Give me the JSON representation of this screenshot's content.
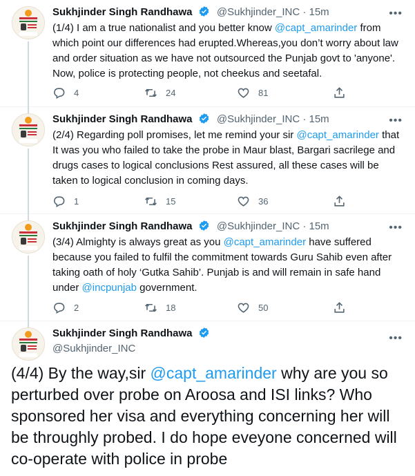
{
  "author": {
    "name": "Sukhjinder Singh Randhawa",
    "handle": "@Sukhjinder_INC",
    "avatar_text": "ਸੁਖਜਿੰਦਰ ਸਿੰਘ ਰੰਧਾਵਾ"
  },
  "tweets": [
    {
      "time": "15m",
      "text_parts": [
        "(1/4) I am a true nationalist and you better know ",
        "@capt_amarinder",
        " from which point our differences had erupted.Whereas,you don’t worry about law and order situation as we have not outsourced the Punjab govt to 'anyone'. Now, police is protecting people, not cheekus and seetafal."
      ],
      "replies": "4",
      "retweets": "24",
      "likes": "81"
    },
    {
      "time": "15m",
      "text_parts": [
        "(2/4) Regarding poll promises, let me remind your sir ",
        "@capt_amarinder",
        " that It was you who failed to take the probe in Maur blast, Bargari sacrilege and drugs cases to logical conclusions Rest assured, all these cases will be taken to logical conclusion in coming days."
      ],
      "replies": "1",
      "retweets": "15",
      "likes": "36"
    },
    {
      "time": "15m",
      "text_parts": [
        "(3/4) Almighty is always great as you ",
        "@capt_amarinder",
        " have suffered because you failed to fulfil the commitment towards Guru Sahib even after taking oath of holy ‘Gutka Sahib’. Punjab is and will remain in safe hand under ",
        "@incpunjab",
        " government."
      ],
      "replies": "2",
      "retweets": "18",
      "likes": "50"
    },
    {
      "text_parts": [
        "(4/4) By the way,sir ",
        "@capt_amarinder",
        " why are you so perturbed over probe on Aroosa and ISI links? Who sponsored her visa and everything concerning her will be throughly probed. I do hope eveyone concerned will co-operate with police in probe"
      ]
    }
  ],
  "separator": "·",
  "icons": {
    "verified": "verified-badge-icon",
    "more": "more-options-icon",
    "reply": "reply-icon",
    "retweet": "retweet-icon",
    "like": "like-icon",
    "share": "share-icon"
  },
  "colors": {
    "accent": "#1d9bf0",
    "secondary_text": "#536471",
    "thread_line": "#cfd9de"
  }
}
